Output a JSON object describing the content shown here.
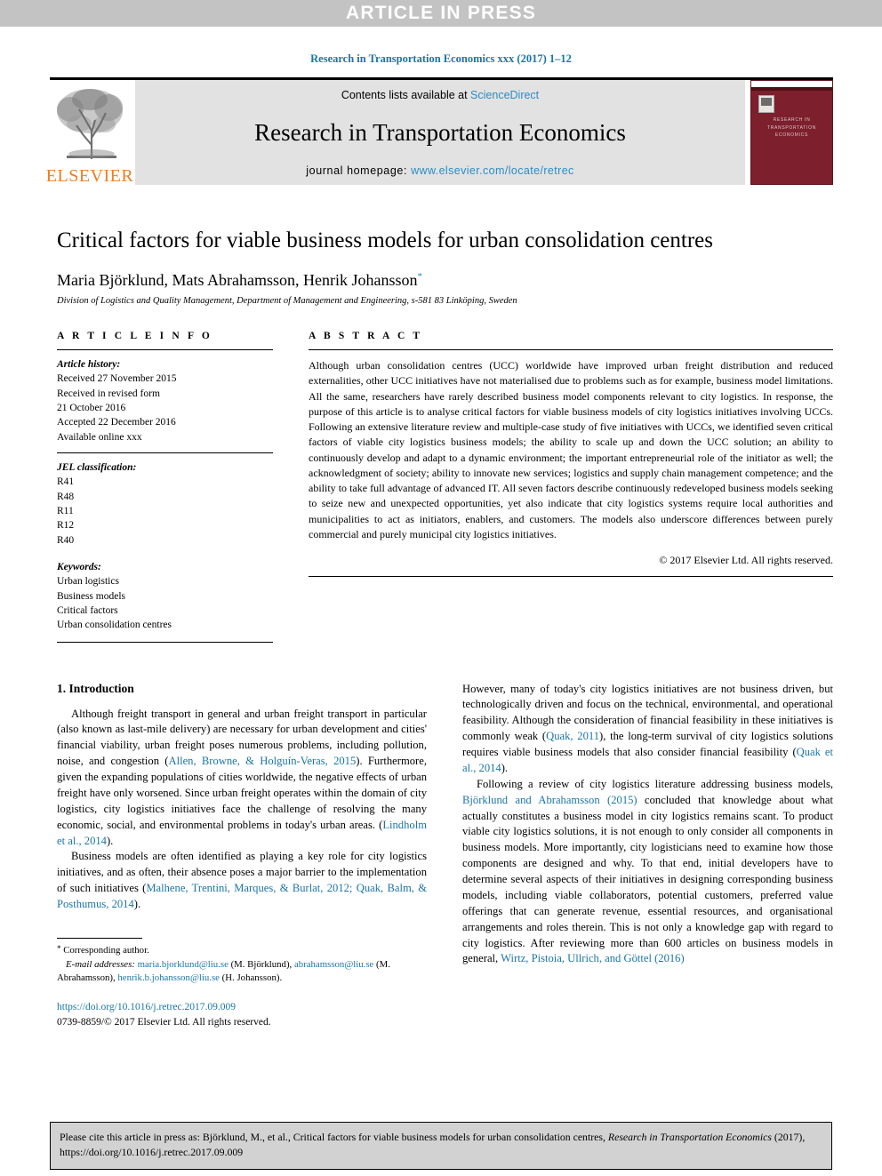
{
  "banner": {
    "text": "ARTICLE IN PRESS"
  },
  "journal_ref": "Research in Transportation Economics xxx (2017) 1–12",
  "masthead": {
    "publisher": "ELSEVIER",
    "contents_prefix": "Contents lists available at ",
    "contents_link": "ScienceDirect",
    "journal_title": "Research in Transportation Economics",
    "homepage_prefix": "journal homepage: ",
    "homepage_url": "www.elsevier.com/locate/retrec",
    "cover_title_line1": "RESEARCH IN",
    "cover_title_line2": "TRANSPORTATION ECONOMICS",
    "cover_color": "#7d1f2c",
    "link_color": "#2b8cc4",
    "brand_color": "#ef7d22"
  },
  "article": {
    "title": "Critical factors for viable business models for urban consolidation centres",
    "authors": "Maria Björklund, Mats Abrahamsson, Henrik Johansson",
    "author_marker": "*",
    "affiliation": "Division of Logistics and Quality Management, Department of Management and Engineering, s-581 83 Linköping, Sweden"
  },
  "info": {
    "heading": "A R T I C L E   I N F O",
    "history_label": "Article history:",
    "history": [
      "Received 27 November 2015",
      "Received in revised form",
      "21 October 2016",
      "Accepted 22 December 2016",
      "Available online xxx"
    ],
    "jel_label": "JEL classification:",
    "jel": [
      "R41",
      "R48",
      "R11",
      "R12",
      "R40"
    ],
    "keywords_label": "Keywords:",
    "keywords": [
      "Urban logistics",
      "Business models",
      "Critical factors",
      "Urban consolidation centres"
    ]
  },
  "abstract": {
    "heading": "A B S T R A C T",
    "text": "Although urban consolidation centres (UCC) worldwide have improved urban freight distribution and reduced externalities, other UCC initiatives have not materialised due to problems such as for example, business model limitations. All the same, researchers have rarely described business model components relevant to city logistics. In response, the purpose of this article is to analyse critical factors for viable business models of city logistics initiatives involving UCCs. Following an extensive literature review and multiple-case study of five initiatives with UCCs, we identified seven critical factors of viable city logistics business models; the ability to scale up and down the UCC solution; an ability to continuously develop and adapt to a dynamic environment; the important entrepreneurial role of the initiator as well; the acknowledgment of society; ability to innovate new services; logistics and supply chain management competence; and the ability to take full advantage of advanced IT. All seven factors describe continuously redeveloped business models seeking to seize new and unexpected opportunities, yet also indicate that city logistics systems require local authorities and municipalities to act as initiators, enablers, and customers. The models also underscore differences between purely commercial and purely municipal city logistics initiatives.",
    "copyright": "© 2017 Elsevier Ltd. All rights reserved."
  },
  "introduction": {
    "heading": "1. Introduction",
    "left_p1_a": "Although freight transport in general and urban freight transport in particular (also known as last-mile delivery) are necessary for urban development and cities' financial viability, urban freight poses numerous problems, including pollution, noise, and congestion (",
    "left_p1_cite1": "Allen, Browne, & Holguín-Veras, 2015",
    "left_p1_b": "). Furthermore, given the expanding populations of cities worldwide, the negative effects of urban freight have only worsened. Since urban freight operates within the domain of city logistics, city logistics initiatives face the challenge of resolving the many economic, social, and environmental problems in today's urban areas. (",
    "left_p1_cite2": "Lindholm et al., 2014",
    "left_p1_c": ").",
    "left_p2_a": "Business models are often identified as playing a key role for city logistics initiatives, and as often, their absence poses a major barrier to the implementation of such initiatives (",
    "left_p2_cite1": "Malhene, Trentini, Marques, & Burlat, 2012; Quak, Balm, & Posthumus, 2014",
    "left_p2_b": ").",
    "right_p1_a": "However, many of today's city logistics initiatives are not business driven, but technologically driven and focus on the technical, environmental, and operational feasibility. Although the consideration of financial feasibility in these initiatives is commonly weak (",
    "right_p1_cite1": "Quak, 2011",
    "right_p1_b": "), the long-term survival of city logistics solutions requires viable business models that also consider financial feasibility (",
    "right_p1_cite2": "Quak et al., 2014",
    "right_p1_c": ").",
    "right_p2_a": "Following a review of city logistics literature addressing business models, ",
    "right_p2_cite1": "Björklund and Abrahamsson (2015)",
    "right_p2_b": " concluded that knowledge about what actually constitutes a business model in city logistics remains scant. To product viable city logistics solutions, it is not enough to only consider all components in business models. More importantly, city logisticians need to examine how those components are designed and why. To that end, initial developers have to determine several aspects of their initiatives in designing corresponding business models, including viable collaborators, potential customers, preferred value offerings that can generate revenue, essential resources, and organisational arrangements and roles therein. This is not only a knowledge gap with regard to city logistics. After reviewing more than 600 articles on business models in general, ",
    "right_p2_cite2": "Wirtz, Pistoia, Ullrich, and Göttel (2016)"
  },
  "footnotes": {
    "corresponding": "Corresponding author.",
    "email_label": "E-mail addresses:",
    "email1": "maria.bjorklund@liu.se",
    "email1_name": " (M. Björklund), ",
    "email2": "abrahamsson@liu.se",
    "email2_name": " (M. Abrahamsson), ",
    "email3": "henrik.b.johansson@liu.se",
    "email3_name": " (H. Johansson).",
    "doi": "https://doi.org/10.1016/j.retrec.2017.09.009",
    "issn": "0739-8859/© 2017 Elsevier Ltd. All rights reserved."
  },
  "cite_box": {
    "prefix": "Please cite this article in press as: Björklund, M., et al., Critical factors for viable business models for urban consolidation centres, ",
    "journal_italic": "Research in Transportation Economics",
    "suffix": " (2017), https://doi.org/10.1016/j.retrec.2017.09.009"
  }
}
